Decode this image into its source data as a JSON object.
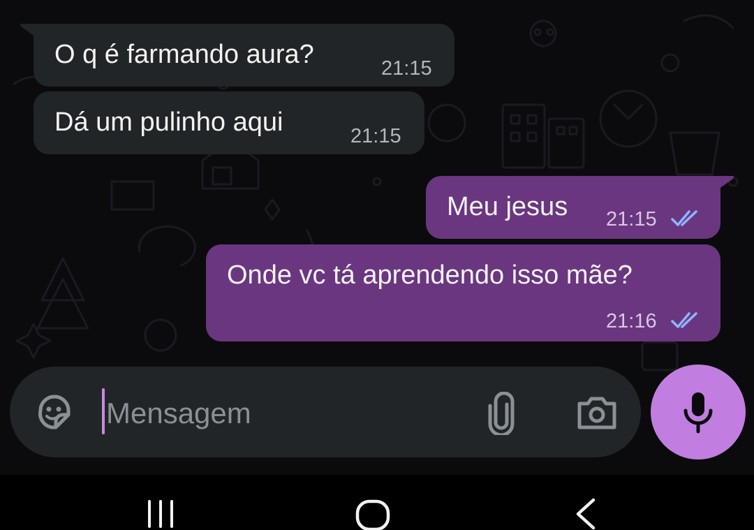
{
  "messages": [
    {
      "direction": "incoming",
      "text": "O q é farmando aura?",
      "time": "21:15"
    },
    {
      "direction": "incoming",
      "text": "Dá um pulinho aqui",
      "time": "21:15"
    },
    {
      "direction": "outgoing",
      "text": "Meu jesus",
      "time": "21:15",
      "status": "read"
    },
    {
      "direction": "outgoing",
      "text": "Onde vc tá aprendendo isso mãe?",
      "time": "21:16",
      "status": "read"
    }
  ],
  "composer": {
    "placeholder": "Mensagem",
    "icons": [
      "sticker-icon",
      "paperclip-icon",
      "camera-icon",
      "microphone-icon"
    ]
  },
  "navigation": {
    "icons": [
      "recent-apps-icon",
      "home-icon",
      "back-icon"
    ]
  },
  "colors": {
    "background": "#0b0b0d",
    "incoming_bubble": "#222527",
    "outgoing_bubble": "#6a3680",
    "read_ticks": "#8fb4ff",
    "mic_button": "#c17ee0",
    "caret": "#c98be0"
  }
}
